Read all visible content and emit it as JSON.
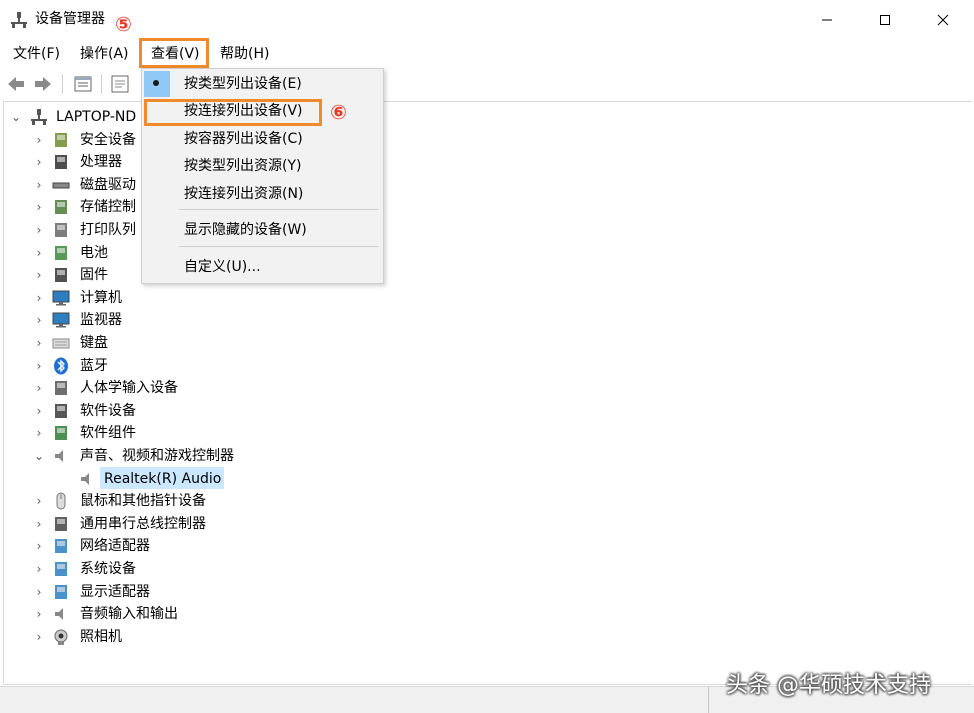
{
  "window": {
    "title": "设备管理器",
    "controls": [
      "minimize-icon",
      "maximize-icon",
      "close-icon"
    ]
  },
  "annotations": {
    "step5": "⑤",
    "step6": "⑥",
    "highlight_color": "#f08a2a",
    "step_color": "#e8392a"
  },
  "menubar": {
    "file": "文件(F)",
    "action": "操作(A)",
    "view": "查看(V)",
    "help": "帮助(H)"
  },
  "toolbar": {
    "icons": [
      "back-arrow-icon",
      "forward-arrow-icon",
      "properties-icon",
      "help-icon"
    ]
  },
  "tree": {
    "root": "LAPTOP-ND",
    "categories": [
      {
        "label": "安全设备",
        "icon": "security-device-icon",
        "expanded": false
      },
      {
        "label": "处理器",
        "icon": "processor-icon",
        "expanded": false
      },
      {
        "label": "磁盘驱动",
        "icon": "disk-drive-icon",
        "expanded": false
      },
      {
        "label": "存储控制",
        "icon": "storage-controller-icon",
        "expanded": false
      },
      {
        "label": "打印队列",
        "icon": "print-queue-icon",
        "expanded": false
      },
      {
        "label": "电池",
        "icon": "battery-icon",
        "expanded": false
      },
      {
        "label": "固件",
        "icon": "firmware-icon",
        "expanded": false
      },
      {
        "label": "计算机",
        "icon": "computer-icon",
        "expanded": false
      },
      {
        "label": "监视器",
        "icon": "monitor-icon",
        "expanded": false
      },
      {
        "label": "键盘",
        "icon": "keyboard-icon",
        "expanded": false
      },
      {
        "label": "蓝牙",
        "icon": "bluetooth-icon",
        "expanded": false
      },
      {
        "label": "人体学输入设备",
        "icon": "hid-icon",
        "expanded": false
      },
      {
        "label": "软件设备",
        "icon": "software-device-icon",
        "expanded": false
      },
      {
        "label": "软件组件",
        "icon": "software-component-icon",
        "expanded": false
      },
      {
        "label": "声音、视频和游戏控制器",
        "icon": "sound-icon",
        "expanded": true
      },
      {
        "label": "鼠标和其他指针设备",
        "icon": "mouse-icon",
        "expanded": false
      },
      {
        "label": "通用串行总线控制器",
        "icon": "usb-icon",
        "expanded": false
      },
      {
        "label": "网络适配器",
        "icon": "network-adapter-icon",
        "expanded": false
      },
      {
        "label": "系统设备",
        "icon": "system-device-icon",
        "expanded": false
      },
      {
        "label": "显示适配器",
        "icon": "display-adapter-icon",
        "expanded": false
      },
      {
        "label": "音频输入和输出",
        "icon": "audio-io-icon",
        "expanded": false
      },
      {
        "label": "照相机",
        "icon": "camera-icon",
        "expanded": false
      }
    ],
    "sound_child": "Realtek(R) Audio"
  },
  "view_menu": {
    "items": [
      {
        "label": "按类型列出设备(E)",
        "checked": true
      },
      {
        "label": "按连接列出设备(V)",
        "checked": false
      },
      {
        "label": "按容器列出设备(C)",
        "checked": false
      },
      {
        "label": "按类型列出资源(Y)",
        "checked": false
      },
      {
        "label": "按连接列出资源(N)",
        "checked": false
      },
      {
        "label": "显示隐藏的设备(W)",
        "checked": false
      },
      {
        "label": "自定义(U)...",
        "checked": false
      }
    ]
  },
  "watermark": "头条 @华硕技术支持"
}
